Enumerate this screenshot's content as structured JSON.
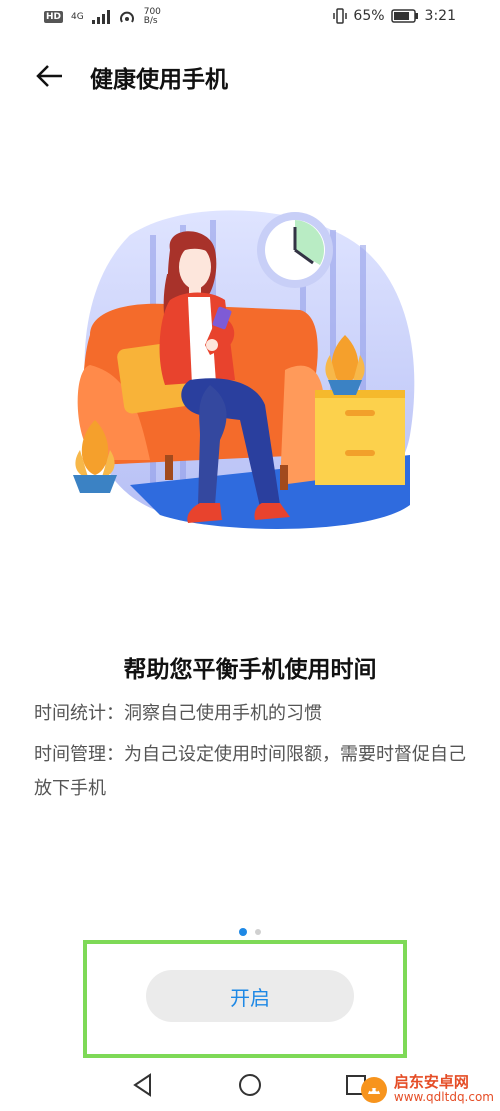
{
  "status_bar": {
    "left_badge": "HD",
    "network": "4G",
    "speed_value": "700",
    "speed_unit": "B/s",
    "battery": "65%",
    "time": "3:21"
  },
  "app_bar": {
    "back_icon": "arrow-left-icon",
    "title": "健康使用手机"
  },
  "main": {
    "heading": "帮助您平衡手机使用时间",
    "description_lines": [
      "时间统计：洞察自己使用手机的习惯",
      "时间管理：为自己设定使用时间限额，需要时督促自己放下手机"
    ],
    "page_indicator": {
      "count": 2,
      "active_index": 0
    }
  },
  "button": {
    "label": "开启"
  },
  "navigation": {
    "back": "back-triangle-icon",
    "home": "home-circle-icon",
    "recents": "recents-square-icon"
  },
  "watermark": {
    "title": "启东安卓网",
    "url": "www.qdltdq.com"
  },
  "colors": {
    "accent": "#1e88e5",
    "highlight": "#7ed957",
    "button_bg": "#ebebeb"
  }
}
